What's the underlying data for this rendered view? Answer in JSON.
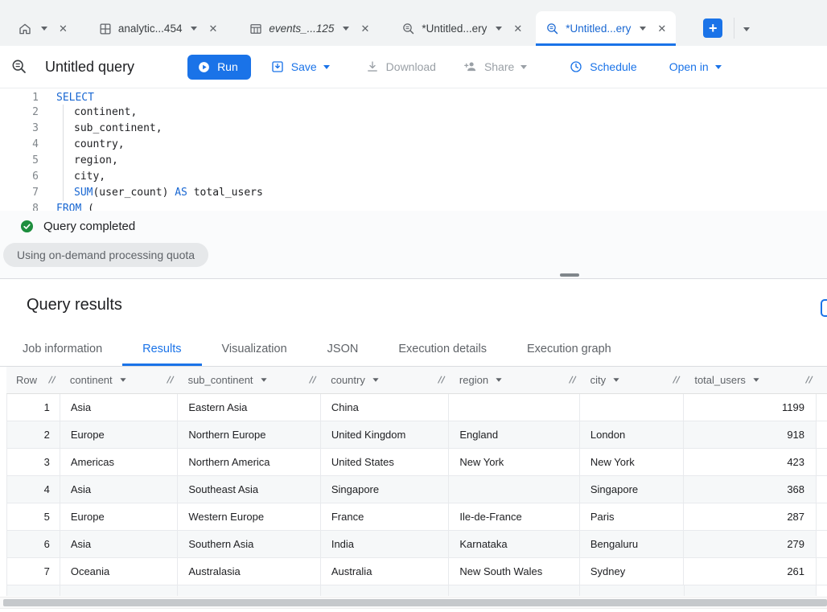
{
  "tab_strip": {
    "tabs": [
      {
        "label": "",
        "icon": "home"
      },
      {
        "label": "analytic...454",
        "icon": "dataset"
      },
      {
        "label": "events_...125",
        "icon": "table"
      },
      {
        "label": "*Untitled...ery",
        "icon": "query"
      },
      {
        "label": "*Untitled...ery",
        "icon": "query"
      }
    ],
    "close_glyph": "✕",
    "new_tab_label": "+"
  },
  "toolbar": {
    "title": "Untitled query",
    "run_label": "Run",
    "save_label": "Save",
    "download_label": "Download",
    "share_label": "Share",
    "schedule_label": "Schedule",
    "open_in_label": "Open in"
  },
  "editor": {
    "line_numbers": [
      "1",
      "2",
      "3",
      "4",
      "5",
      "6",
      "7",
      "8"
    ],
    "code": {
      "l1_kw": "SELECT",
      "l2": "continent,",
      "l3": "sub_continent,",
      "l4": "country,",
      "l5": "region,",
      "l6": "city,",
      "l7_kw1": "SUM",
      "l7_p1": "(user_count) ",
      "l7_kw2": "AS",
      "l7_p2": " total_users",
      "l8_kw": "FROM",
      "l8_p1": " ("
    }
  },
  "status": {
    "completed_text": "Query completed",
    "quota_chip": "Using on-demand processing quota"
  },
  "results": {
    "title": "Query results",
    "tabs": [
      "Job information",
      "Results",
      "Visualization",
      "JSON",
      "Execution details",
      "Execution graph"
    ],
    "active_tab": "Results"
  },
  "table": {
    "headers": [
      "Row",
      "continent",
      "sub_continent",
      "country",
      "region",
      "city",
      "total_users"
    ],
    "rows": [
      [
        "1",
        "Asia",
        "Eastern Asia",
        "China",
        "",
        "",
        "1199"
      ],
      [
        "2",
        "Europe",
        "Northern Europe",
        "United Kingdom",
        "England",
        "London",
        "918"
      ],
      [
        "3",
        "Americas",
        "Northern America",
        "United States",
        "New York",
        "New York",
        "423"
      ],
      [
        "4",
        "Asia",
        "Southeast Asia",
        "Singapore",
        "",
        "Singapore",
        "368"
      ],
      [
        "5",
        "Europe",
        "Western Europe",
        "France",
        "Ile-de-France",
        "Paris",
        "287"
      ],
      [
        "6",
        "Asia",
        "Southern Asia",
        "India",
        "Karnataka",
        "Bengaluru",
        "279"
      ],
      [
        "7",
        "Oceania",
        "Australasia",
        "Australia",
        "New South Wales",
        "Sydney",
        "261"
      ]
    ]
  },
  "colors": {
    "accent_blue": "#1a73e8",
    "active_text_blue": "#1967d2",
    "keyword_blue": "#1967d2",
    "success_green": "#1e8e3e",
    "disabled_gray": "#9aa0a6",
    "tab_strip_bg": "#f1f3f4"
  }
}
